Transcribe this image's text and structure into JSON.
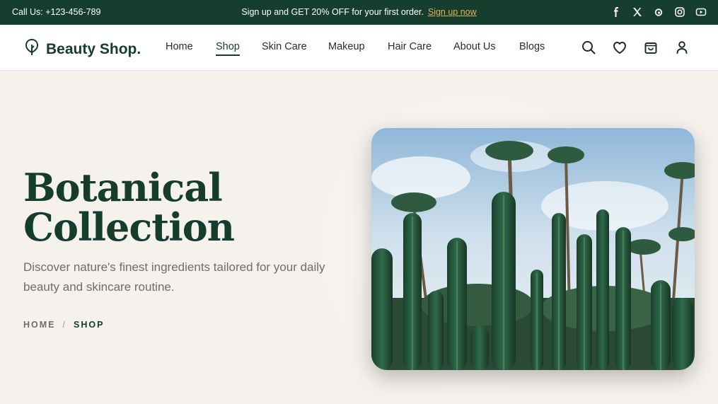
{
  "topbar": {
    "call": "Call Us: +123-456-789",
    "promo_text": "Sign up and GET 20% OFF for your first order.",
    "promo_link": "Sign up now",
    "socials": [
      "facebook-icon",
      "x-icon",
      "threads-icon",
      "instagram-icon",
      "youtube-icon"
    ]
  },
  "header": {
    "brand": "Beauty Shop.",
    "nav": [
      {
        "label": "Home"
      },
      {
        "label": "Shop",
        "active": true
      },
      {
        "label": "Skin Care"
      },
      {
        "label": "Makeup"
      },
      {
        "label": "Hair Care"
      },
      {
        "label": "About Us"
      },
      {
        "label": "Blogs"
      }
    ],
    "icons": [
      "search-icon",
      "heart-icon",
      "cart-icon",
      "user-icon"
    ]
  },
  "hero": {
    "title_line1": "Botanical",
    "title_line2": "Collection",
    "subtitle": "Discover nature's finest ingredients tailored for your daily beauty and skincare routine.",
    "breadcrumb": {
      "home": "HOME",
      "sep": "/",
      "current": "SHOP"
    }
  },
  "colors": {
    "primary": "#153e2e",
    "accent": "#e8b04a",
    "background": "#f5f1ec"
  }
}
